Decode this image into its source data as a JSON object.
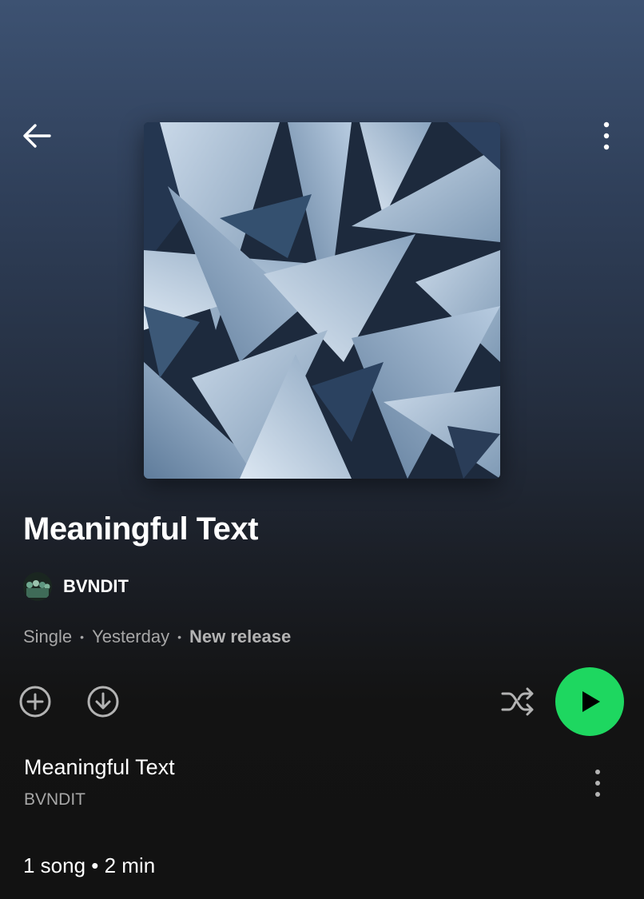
{
  "header": {
    "back_icon": "arrow-left-icon",
    "more_icon": "more-vertical-icon"
  },
  "album": {
    "title": "Meaningful Text",
    "cover_icon": "album-cover-abstract-art",
    "artist": {
      "name": "BVNDIT",
      "avatar_icon": "artist-avatar"
    },
    "meta": {
      "type": "Single",
      "date": "Yesterday",
      "badge": "New release",
      "separator": "•"
    }
  },
  "actions": {
    "add_icon": "plus-circle-icon",
    "download_icon": "download-circle-icon",
    "shuffle_icon": "shuffle-icon",
    "play_icon": "play-icon",
    "accent_color": "#1ed760"
  },
  "tracks": [
    {
      "title": "Meaningful Text",
      "artist": "BVNDIT",
      "more_icon": "more-vertical-icon"
    }
  ],
  "summary": "1 song • 2 min"
}
